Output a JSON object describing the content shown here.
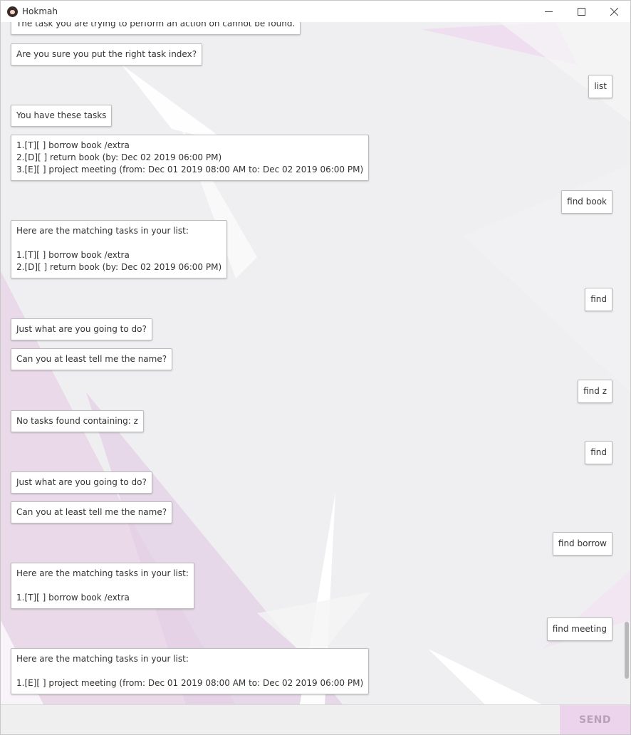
{
  "window": {
    "title": "Hokmah"
  },
  "messages": [
    {
      "role": "bot",
      "text": "The task you are trying to perform an action on cannot be found."
    },
    {
      "role": "bot",
      "text": "Are you sure you put the right task index?"
    },
    {
      "role": "user",
      "text": "list"
    },
    {
      "role": "bot",
      "text": "You have these tasks"
    },
    {
      "role": "bot",
      "text": "1.[T][ ] borrow book /extra\n2.[D][ ] return book (by: Dec 02 2019 06:00 PM)\n3.[E][ ] project meeting (from: Dec 01 2019 08:00 AM to: Dec 02 2019 06:00 PM)"
    },
    {
      "role": "user",
      "text": "find book"
    },
    {
      "role": "bot",
      "text": "Here are the matching tasks in your list:\n\n1.[T][ ] borrow book /extra\n2.[D][ ] return book (by: Dec 02 2019 06:00 PM)"
    },
    {
      "role": "user",
      "text": "find"
    },
    {
      "role": "bot",
      "text": "Just what are you going to do?"
    },
    {
      "role": "bot",
      "text": "Can you at least tell me the name?"
    },
    {
      "role": "user",
      "text": "find z"
    },
    {
      "role": "bot",
      "text": "No tasks found containing: z"
    },
    {
      "role": "user",
      "text": "find"
    },
    {
      "role": "bot",
      "text": "Just what are you going to do?"
    },
    {
      "role": "bot",
      "text": "Can you at least tell me the name?"
    },
    {
      "role": "user",
      "text": "find borrow"
    },
    {
      "role": "bot",
      "text": "Here are the matching tasks in your list:\n\n1.[T][ ] borrow book /extra"
    },
    {
      "role": "user",
      "text": "find meeting"
    },
    {
      "role": "bot",
      "text": "Here are the matching tasks in your list:\n\n1.[E][ ] project meeting (from: Dec 01 2019 08:00 AM to: Dec 02 2019 06:00 PM)"
    }
  ],
  "input": {
    "value": "",
    "placeholder": ""
  },
  "send_label": "SEND",
  "colors": {
    "send_bg": "#ebd4ec",
    "send_text": "#b8a0b8",
    "accent": "#e9d3ea"
  },
  "icons": {
    "app": "app-avatar-icon",
    "minimize": "minimize-icon",
    "maximize": "maximize-icon",
    "close": "close-icon"
  }
}
